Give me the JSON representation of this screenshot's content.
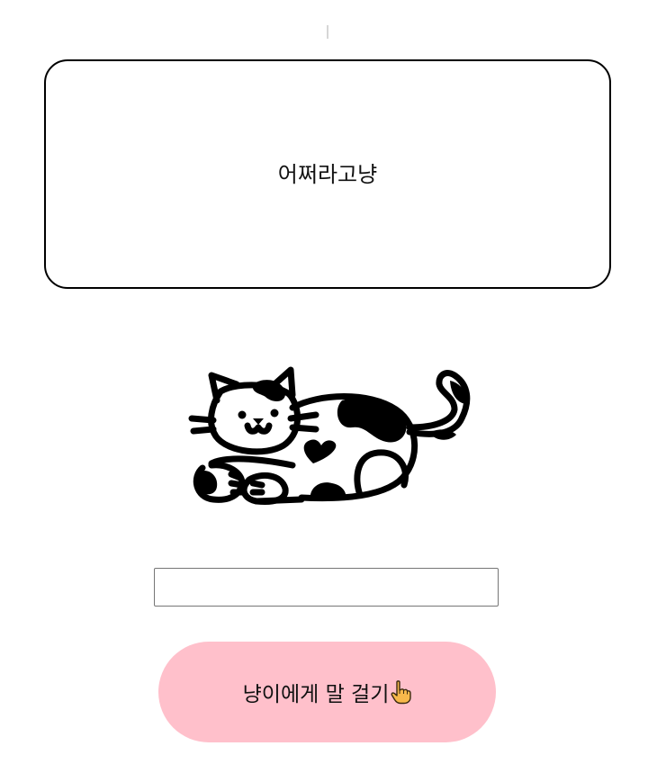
{
  "speech_bubble": {
    "text": "어쩌라고냥"
  },
  "cat": {
    "icon": "calico-cat-icon"
  },
  "message": {
    "value": "",
    "placeholder": ""
  },
  "talk_button": {
    "label": "냥이에게 말 걸기",
    "icon": "pointing-hand-icon"
  },
  "colors": {
    "button_bg": "#ffc0cb",
    "border": "#000000"
  }
}
